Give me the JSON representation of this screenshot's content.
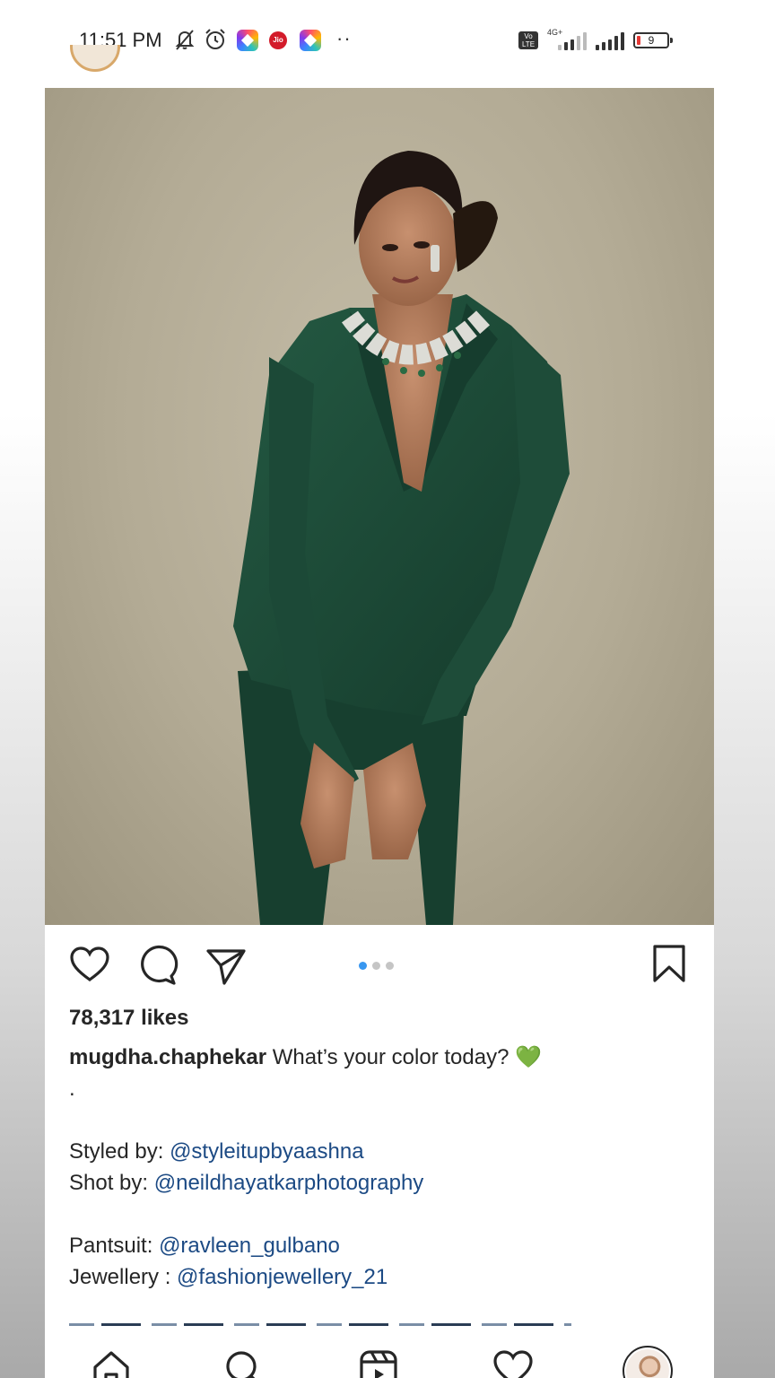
{
  "status_bar": {
    "time": "11:51 PM",
    "icons": [
      "mute-bell-icon",
      "alarm-icon",
      "app-icon",
      "jio-icon",
      "app-icon",
      "more-dots-icon"
    ],
    "jio_label": "Jio",
    "more_label": "··",
    "volte_label": "Vo LTE",
    "network_label": "4G+",
    "battery_level": "9"
  },
  "post": {
    "image_alt": "Woman in a dark green pantsuit with a statement necklace posing against a beige studio backdrop",
    "carousel": {
      "total": 3,
      "active_index": 0
    },
    "likes": "78,317 likes",
    "username": "mugdha.chaphekar",
    "caption_text": "What’s your color today? 💚",
    "caption_dot": ".",
    "credits": [
      {
        "label": "Styled by: ",
        "mention": "@styleitupbyaashna"
      },
      {
        "label": "Shot by: ",
        "mention": "@neildhayatkarphotography"
      }
    ],
    "items": [
      {
        "label": "Pantsuit: ",
        "mention": "@ravleen_gulbano"
      },
      {
        "label": "Jewellery : ",
        "mention": "@fashionjewellery_21"
      }
    ]
  },
  "actions": {
    "like": "heart-icon",
    "comment": "comment-icon",
    "share": "send-icon",
    "save": "bookmark-icon"
  },
  "bottom_nav": [
    "home-icon",
    "search-icon",
    "reels-icon",
    "activity-heart-icon",
    "profile-avatar"
  ],
  "colors": {
    "text": "#262626",
    "mention": "#1c4a84",
    "active_dot": "#3897f0",
    "backdrop": "#b3ab95",
    "suit_green": "#1d4a37"
  }
}
